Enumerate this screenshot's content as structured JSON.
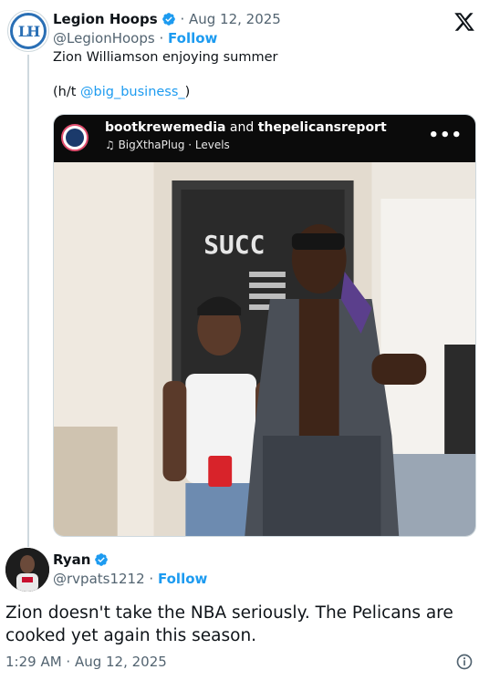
{
  "colors": {
    "accent": "#1d9bf0",
    "text": "#0f1419",
    "muted": "#536471",
    "border": "#cfd9de"
  },
  "original_tweet": {
    "author_name": "Legion Hoops",
    "date": "· Aug 12, 2025",
    "handle": "@LegionHoops",
    "separator": "·",
    "follow_label": "Follow",
    "text_line1": "Zion Williamson enjoying summer",
    "text_prefix": "(h/t ",
    "mention": "@big_business_",
    "text_suffix": ")",
    "icons": {
      "avatar": "legion-hoops-logo",
      "verified": "verified-badge-icon",
      "brand": "x-logo-icon"
    }
  },
  "embedded_media": {
    "users_part1": "bootkrewemedia",
    "users_and": " and ",
    "users_part2": "thepelicansreport",
    "audio_icon": "music-note-icon",
    "audio_label": "BigXthaPlug · Levels",
    "more_icon": "more-dots-icon",
    "photo_sign_text": "SUCC"
  },
  "reply": {
    "author_name": "Ryan",
    "handle": "@rvpats1212",
    "separator": "·",
    "follow_label": "Follow",
    "text": "Zion doesn't take the NBA seriously. The Pelicans are cooked yet again this season.",
    "timestamp": "1:29 AM · Aug 12, 2025",
    "info_icon": "info-icon"
  }
}
